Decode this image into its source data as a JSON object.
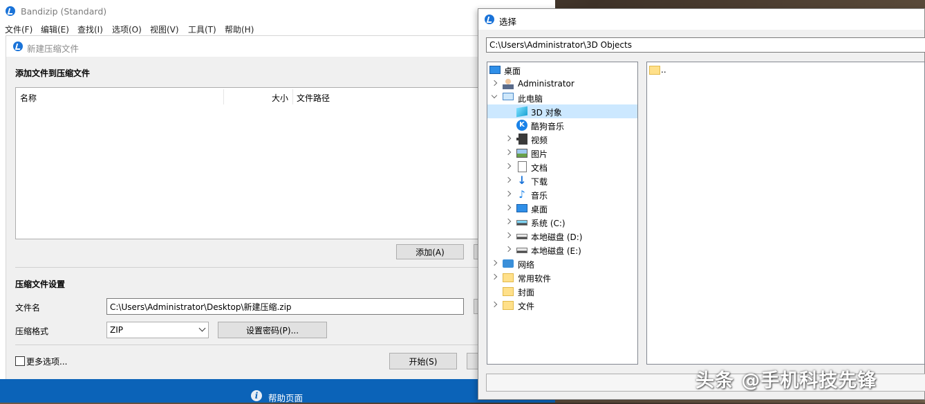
{
  "main": {
    "title": "Bandizip (Standard)",
    "menu": [
      "文件(F)",
      "编辑(E)",
      "查找(I)",
      "选项(O)",
      "视图(V)",
      "工具(T)",
      "帮助(H)"
    ]
  },
  "dialog": {
    "title": "新建压缩文件",
    "add_files_heading": "添加文件到压缩文件",
    "columns": {
      "name": "名称",
      "size": "大小",
      "path": "文件路径"
    },
    "add_button": "添加(A)",
    "settings_heading": "压缩文件设置",
    "filename_label": "文件名",
    "filename_value": "C:\\Users\\Administrator\\Desktop\\新建压缩.zip",
    "format_label": "压缩格式",
    "format_value": "ZIP",
    "password_button": "设置密码(P)...",
    "more_options": "更多选项...",
    "start_button": "开始(S)"
  },
  "taskbar": {
    "help_label": "帮助页面"
  },
  "chooser": {
    "title": "选择",
    "path": "C:\\Users\\Administrator\\3D Objects",
    "tree": [
      {
        "label": "桌面",
        "icon": "desktop-icon"
      },
      {
        "label": "Administrator",
        "icon": "user-icon"
      },
      {
        "label": "此电脑",
        "icon": "computer-icon"
      },
      {
        "label": "3D 对象",
        "icon": "3d-objects-icon"
      },
      {
        "label": "酷狗音乐",
        "icon": "kugou-icon"
      },
      {
        "label": "视频",
        "icon": "video-icon"
      },
      {
        "label": "图片",
        "icon": "pictures-icon"
      },
      {
        "label": "文档",
        "icon": "documents-icon"
      },
      {
        "label": "下载",
        "icon": "download-icon"
      },
      {
        "label": "音乐",
        "icon": "music-icon"
      },
      {
        "label": "桌面",
        "icon": "desktop-icon"
      },
      {
        "label": "系统 (C:)",
        "icon": "system-drive-icon"
      },
      {
        "label": "本地磁盘 (D:)",
        "icon": "drive-icon"
      },
      {
        "label": "本地磁盘 (E:)",
        "icon": "drive-icon"
      },
      {
        "label": "网络",
        "icon": "network-icon"
      },
      {
        "label": "常用软件",
        "icon": "folder-icon"
      },
      {
        "label": "封面",
        "icon": "folder-icon"
      },
      {
        "label": "文件",
        "icon": "folder-icon"
      }
    ],
    "contents": [
      {
        "label": "..",
        "icon": "folder-icon"
      }
    ]
  },
  "watermark": "头条 @手机科技先锋",
  "colors": {
    "accent": "#0b63b8",
    "selection": "#cce8ff",
    "folder": "#ffe08a"
  }
}
